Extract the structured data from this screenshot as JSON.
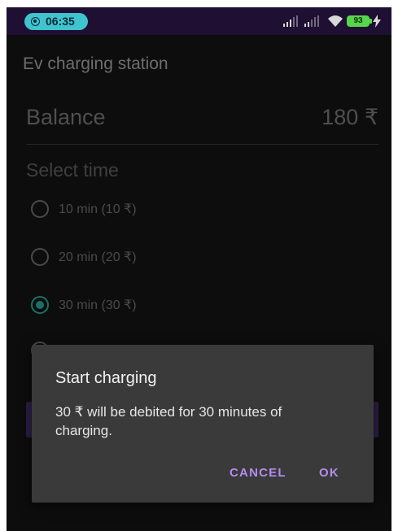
{
  "status_bar": {
    "time": "06:35",
    "battery": "93"
  },
  "app": {
    "title": "Ev charging station",
    "balance_label": "Balance",
    "balance_value": "180 ₹",
    "select_time_label": "Select time",
    "options": [
      {
        "label": "10 min (10 ₹)",
        "checked": false
      },
      {
        "label": "20 min (20 ₹)",
        "checked": false
      },
      {
        "label": "30 min (30 ₹)",
        "checked": true
      }
    ]
  },
  "dialog": {
    "title": "Start charging",
    "message": "30 ₹ will be debited for 30 minutes of charging.",
    "cancel_label": "CANCEL",
    "ok_label": "OK"
  },
  "colors": {
    "accent": "#b48cf0",
    "radio_checked": "#1a6f66",
    "status_bar": "#1e0f33"
  }
}
